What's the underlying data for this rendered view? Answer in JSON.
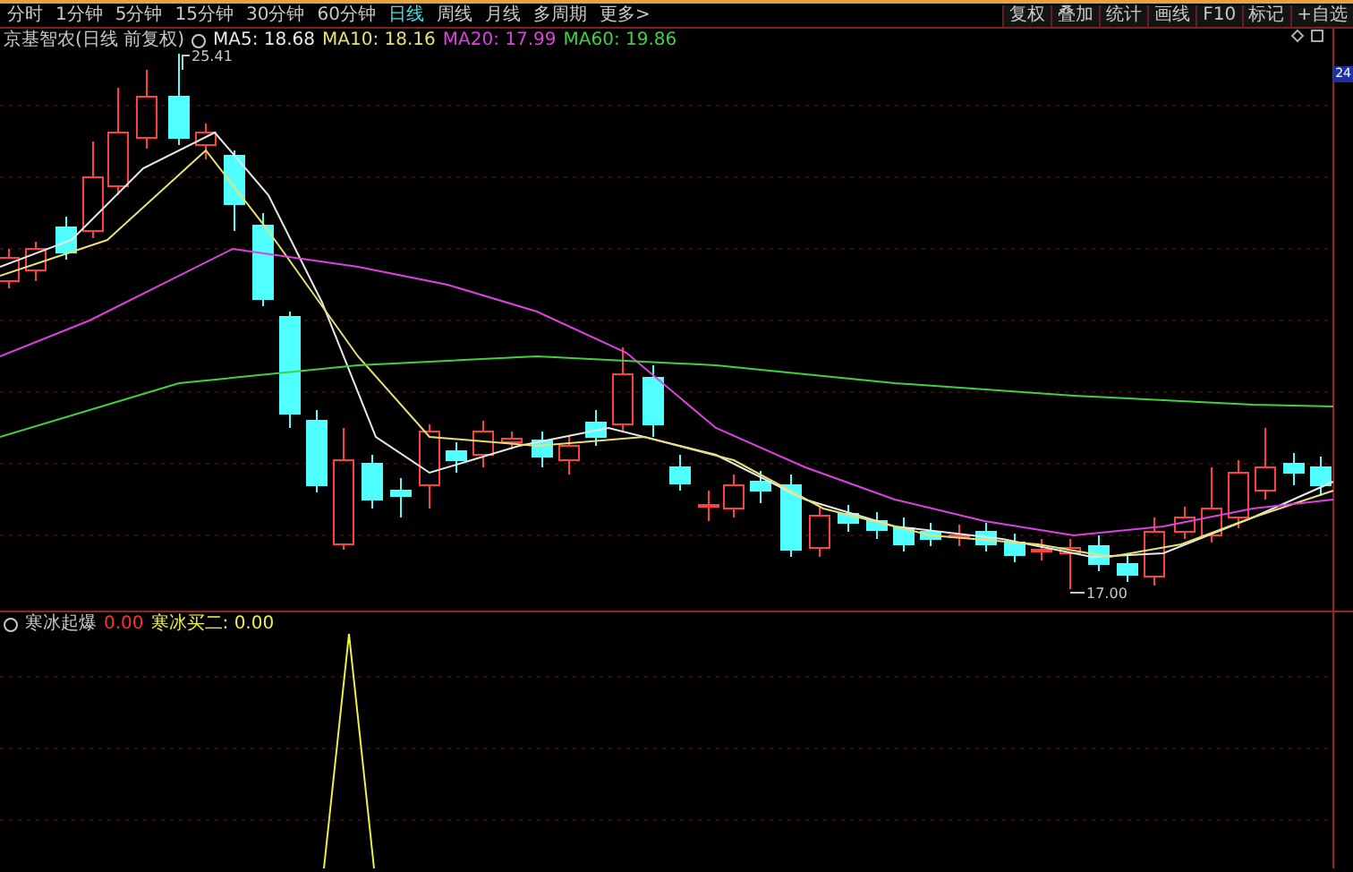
{
  "tabs": [
    {
      "label": "分时",
      "selected": false
    },
    {
      "label": "1分钟",
      "selected": false
    },
    {
      "label": "5分钟",
      "selected": false
    },
    {
      "label": "15分钟",
      "selected": false
    },
    {
      "label": "30分钟",
      "selected": false
    },
    {
      "label": "60分钟",
      "selected": false
    },
    {
      "label": "日线",
      "selected": true
    },
    {
      "label": "周线",
      "selected": false
    },
    {
      "label": "月线",
      "selected": false
    },
    {
      "label": "多周期",
      "selected": false
    },
    {
      "label": "更多>",
      "selected": false
    }
  ],
  "toolbar_buttons": [
    "复权",
    "叠加",
    "统计",
    "画线",
    "F10",
    "标记",
    "+自选"
  ],
  "main_chart": {
    "title": "京基智农(日线 前复权)",
    "indicators": [
      {
        "label": "MA5: 18.68",
        "color": "#e8e8e8"
      },
      {
        "label": "MA10: 18.16",
        "color": "#e8e070"
      },
      {
        "label": "MA20: 17.99",
        "color": "#e040e0"
      },
      {
        "label": "MA60: 19.86",
        "color": "#40d040"
      }
    ],
    "high_label": "25.41",
    "low_label": "17.00",
    "axis_label": "24"
  },
  "sub_chart": {
    "title": "寒冰起爆",
    "indicators": [
      {
        "label": "0.00",
        "color": "#ff3030"
      },
      {
        "label": "寒冰买二: 0.00",
        "color": "#f0f040"
      }
    ]
  }
}
